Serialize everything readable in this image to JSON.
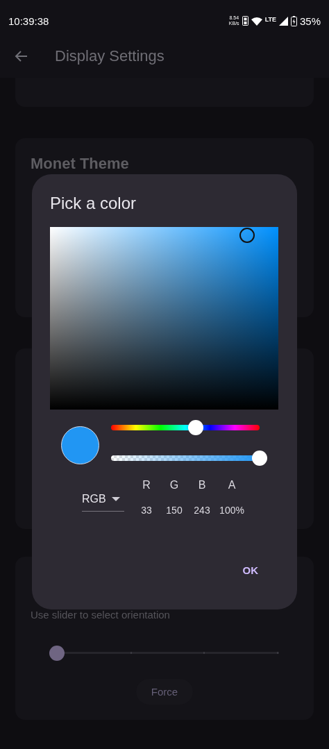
{
  "status_bar": {
    "time": "10:39:38",
    "net_speed": "8.54",
    "net_unit": "KB/s",
    "network": "LTE",
    "battery": "35%"
  },
  "app_bar": {
    "title": "Display Settings"
  },
  "cards": [
    {
      "kind": "blank"
    },
    {
      "kind": "title",
      "title": "Monet Theme"
    },
    {
      "kind": "blank"
    },
    {
      "kind": "orientation",
      "subtitle": "Use slider to select orientation",
      "level": 0,
      "button": "Force"
    }
  ],
  "dialog": {
    "title": "Pick a color",
    "color": "#2196f3",
    "hue_slider": {
      "level": 0.572
    },
    "alpha_slider": {
      "level": 1
    },
    "mode": "RGB",
    "channels": [
      {
        "label": "R",
        "value": "33"
      },
      {
        "label": "G",
        "value": "150"
      },
      {
        "label": "B",
        "value": "243"
      },
      {
        "label": "A",
        "value": "100%"
      }
    ],
    "ok": "OK"
  }
}
